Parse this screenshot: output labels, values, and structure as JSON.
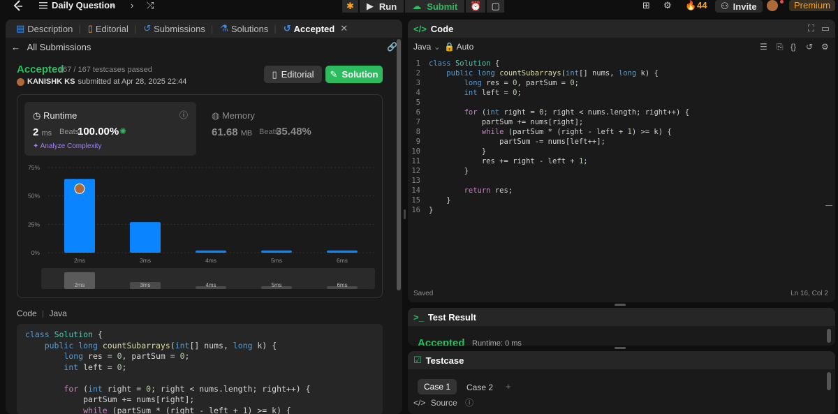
{
  "topbar": {
    "title": "Daily Question",
    "run": "Run",
    "submit": "Submit",
    "streak": "44",
    "invite": "Invite",
    "premium": "Premium"
  },
  "left_tabs": [
    {
      "label": "Description",
      "icon": "document-icon"
    },
    {
      "label": "Editorial",
      "icon": "book-icon"
    },
    {
      "label": "Submissions",
      "icon": "history-icon"
    },
    {
      "label": "Solutions",
      "icon": "flask-icon"
    },
    {
      "label": "Accepted",
      "icon": "history-icon",
      "active": true
    }
  ],
  "submission": {
    "all_submissions": "All Submissions",
    "status": "Accepted",
    "testcases": "167 / 167 testcases passed",
    "author": "KANISHK KS",
    "submitted": "submitted at Apr 28, 2025 22:44",
    "editorial_btn": "Editorial",
    "solution_btn": "Solution"
  },
  "runtime": {
    "label": "Runtime",
    "value": "2",
    "unit": "ms",
    "beats_label": "Beats",
    "beats": "100.00%",
    "analyze": "Analyze Complexity"
  },
  "memory": {
    "label": "Memory",
    "value": "61.68",
    "unit": "MB",
    "beats_label": "Beats",
    "beats": "35.48%"
  },
  "chart_data": {
    "type": "bar",
    "categories": [
      "2ms",
      "3ms",
      "4ms",
      "5ms",
      "6ms"
    ],
    "values": [
      65,
      27,
      2,
      2,
      2
    ],
    "yticks": [
      "75%",
      "50%",
      "25%",
      "0%"
    ],
    "ylim": [
      0,
      75
    ],
    "highlight_index": 0,
    "color": "#0a84ff",
    "minimap_labels": [
      "2ms",
      "3ms",
      "4ms",
      "5ms",
      "6ms"
    ]
  },
  "code_section": {
    "label": "Code",
    "lang": "Java",
    "lines": [
      "class Solution {",
      "    public long countSubarrays(int[] nums, long k) {",
      "        long res = 0, partSum = 0;",
      "        int left = 0;",
      "",
      "        for (int right = 0; right < nums.length; right++) {",
      "            partSum += nums[right];",
      "            while (partSum * (right - left + 1) >= k) {"
    ]
  },
  "editor": {
    "title": "Code",
    "lang": "Java",
    "mode": "Auto",
    "saved": "Saved",
    "position": "Ln 16, Col 2",
    "lines": [
      "class Solution {",
      "    public long countSubarrays(int[] nums, long k) {",
      "        long res = 0, partSum = 0;",
      "        int left = 0;",
      "",
      "        for (int right = 0; right < nums.length; right++) {",
      "            partSum += nums[right];",
      "            while (partSum * (right - left + 1) >= k) {",
      "                partSum -= nums[left++];",
      "            }",
      "            res += right - left + 1;",
      "        }",
      "",
      "        return res;",
      "    }",
      "}"
    ]
  },
  "test_result": {
    "title": "Test Result",
    "status": "Accepted",
    "runtime": "Runtime: 0 ms"
  },
  "testcase": {
    "title": "Testcase",
    "case1": "Case 1",
    "case2": "Case 2",
    "source": "Source"
  }
}
